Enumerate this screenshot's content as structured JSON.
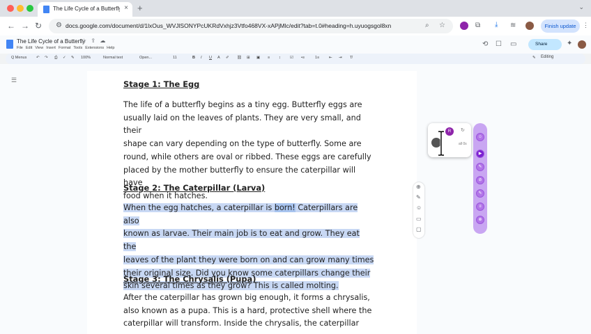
{
  "browser": {
    "tab_title": "The Life Cycle of a Butterfly",
    "tab_close": "×",
    "new_tab": "+",
    "tab_menu": "⌄",
    "back": "←",
    "forward": "→",
    "reload": "↻",
    "url": "docs.google.com/document/d/1lxOus_WVJlSONYPcUKRdVxhjz3Vtfo468VX-xAPjMlc/edit?tab=t.0#heading=h.uyuogsgol8xn",
    "finish_update": "Finish update",
    "menu": "⋮"
  },
  "docs": {
    "title": "The Life Cycle of a Butterfly",
    "title_icons": "☆ ⇪ ☁",
    "menu_items": [
      "File",
      "Edit",
      "View",
      "Insert",
      "Format",
      "Tools",
      "Extensions",
      "Help"
    ],
    "share_label": "Share",
    "toolbar": {
      "search": "Q Menus",
      "zoom": "100%",
      "style": "Normal text",
      "font": "Open...",
      "size": "11",
      "editing": "Editing"
    }
  },
  "document": {
    "h1": "Stage 1: The Egg",
    "p1_line1_a": "The life of a butterfly begi",
    "p1_line1_b": "ns as a tiny egg. Butterfly eggs are",
    "p1_rest": [
      "usually laid on the leaves of plants. They are very small, and their",
      "shape can vary depending on the type of butterfly. Some are",
      "round, while others are oval or ribbed. These eggs are carefully",
      "placed by the mother butterfly to ensure the caterpillar will have",
      "food when it hatches."
    ],
    "h2": "Stage 2: The Caterpillar (Larva)",
    "p2_line1_a": "When the egg hatches, a caterpillar is ",
    "p2_line1_b": "born!",
    "p2_line1_c": " Caterpillars are also",
    "p2_rest": [
      "known as larvae. Their main job is to eat and grow. They eat the",
      "leaves of the plant they were born on and can grow many times",
      "their original size. Did you know some caterpillars change their",
      "skin several times as they grow? This is called molting."
    ],
    "h3": "Stage 3: The Chrysalis (Pupa)",
    "p3": [
      "After the caterpillar has grown big enough, it forms a chrysalis,",
      "also known as a pupa. This is a hard, protective shell where the",
      "caterpillar will transform. Inside the chrysalis, the caterpillar goes"
    ]
  },
  "popup": {
    "badge": "R",
    "refresh": "↻",
    "label": "all 0s"
  },
  "colors": {
    "selection": "#c8d8f4",
    "assistant_bar": "#c9a6f2",
    "share_bg": "#c2e7ff"
  }
}
